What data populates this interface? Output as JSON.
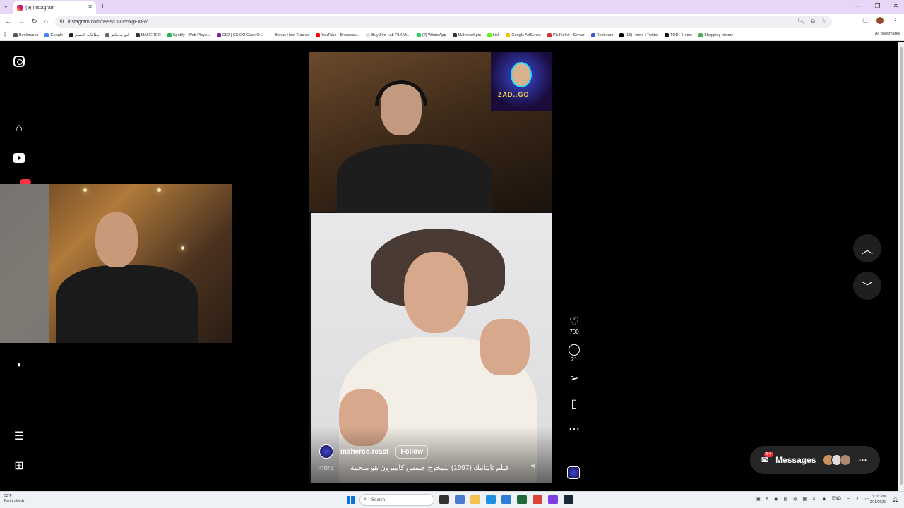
{
  "browser": {
    "tab_title": "(9) Instagram",
    "url": "instagram.com/reels/DUu65xgEX8v/",
    "bookmarks": [
      {
        "label": "Bookmarks",
        "color": "#555555"
      },
      {
        "label": "Google",
        "color": "#4285f4"
      },
      {
        "label": "بطاقات الحسم",
        "color": "#222222"
      },
      {
        "label": "ادوات ماهر",
        "color": "#666666"
      },
      {
        "label": "MAHERCO",
        "color": "#333333"
      },
      {
        "label": "Spotify - Web Playe...",
        "color": "#1db954"
      },
      {
        "label": "CS2 | CS:GO Case O...",
        "color": "#7b1fa2"
      },
      {
        "label": "Bonus Hunt Tracker",
        "color": "#ffffff"
      },
      {
        "label": "YouTube - Broadcas...",
        "color": "#ff0000"
      },
      {
        "label": "Buy Sim-Lab P1X Ui...",
        "color": "#dddddd"
      },
      {
        "label": "(2) WhatsApp",
        "color": "#25d366"
      },
      {
        "label": "MahercoSpin",
        "color": "#333333"
      },
      {
        "label": "kick",
        "color": "#53fc18"
      },
      {
        "label": "Google AdSense",
        "color": "#fbbc04"
      },
      {
        "label": "IRLToolkit • Server",
        "color": "#d32f2f"
      },
      {
        "label": "Restream",
        "color": "#3a5bd9"
      },
      {
        "label": "(16) Home / Twitter",
        "color": "#000000"
      },
      {
        "label": "TOD - Home",
        "color": "#111111"
      },
      {
        "label": "Shopping history",
        "color": "#4caf50"
      }
    ],
    "all_bookmarks": "All Bookmarks"
  },
  "reel": {
    "username": "maherco.react",
    "follow_label": "Follow",
    "caption": "فيلم تايتانيك (1997) للمخرج جيمس كاميرون هو ملحمة",
    "more_label": "more",
    "likes": "700",
    "comments": "21",
    "logo_text": "ZAD..GO"
  },
  "messages": {
    "label": "Messages",
    "badge": "9+"
  },
  "taskbar": {
    "weather_temp": "53°F",
    "weather_desc": "Partly cloudy",
    "search_placeholder": "Search",
    "lang": "ENG",
    "time": "9:18 PM",
    "date": "2/15/2026"
  }
}
